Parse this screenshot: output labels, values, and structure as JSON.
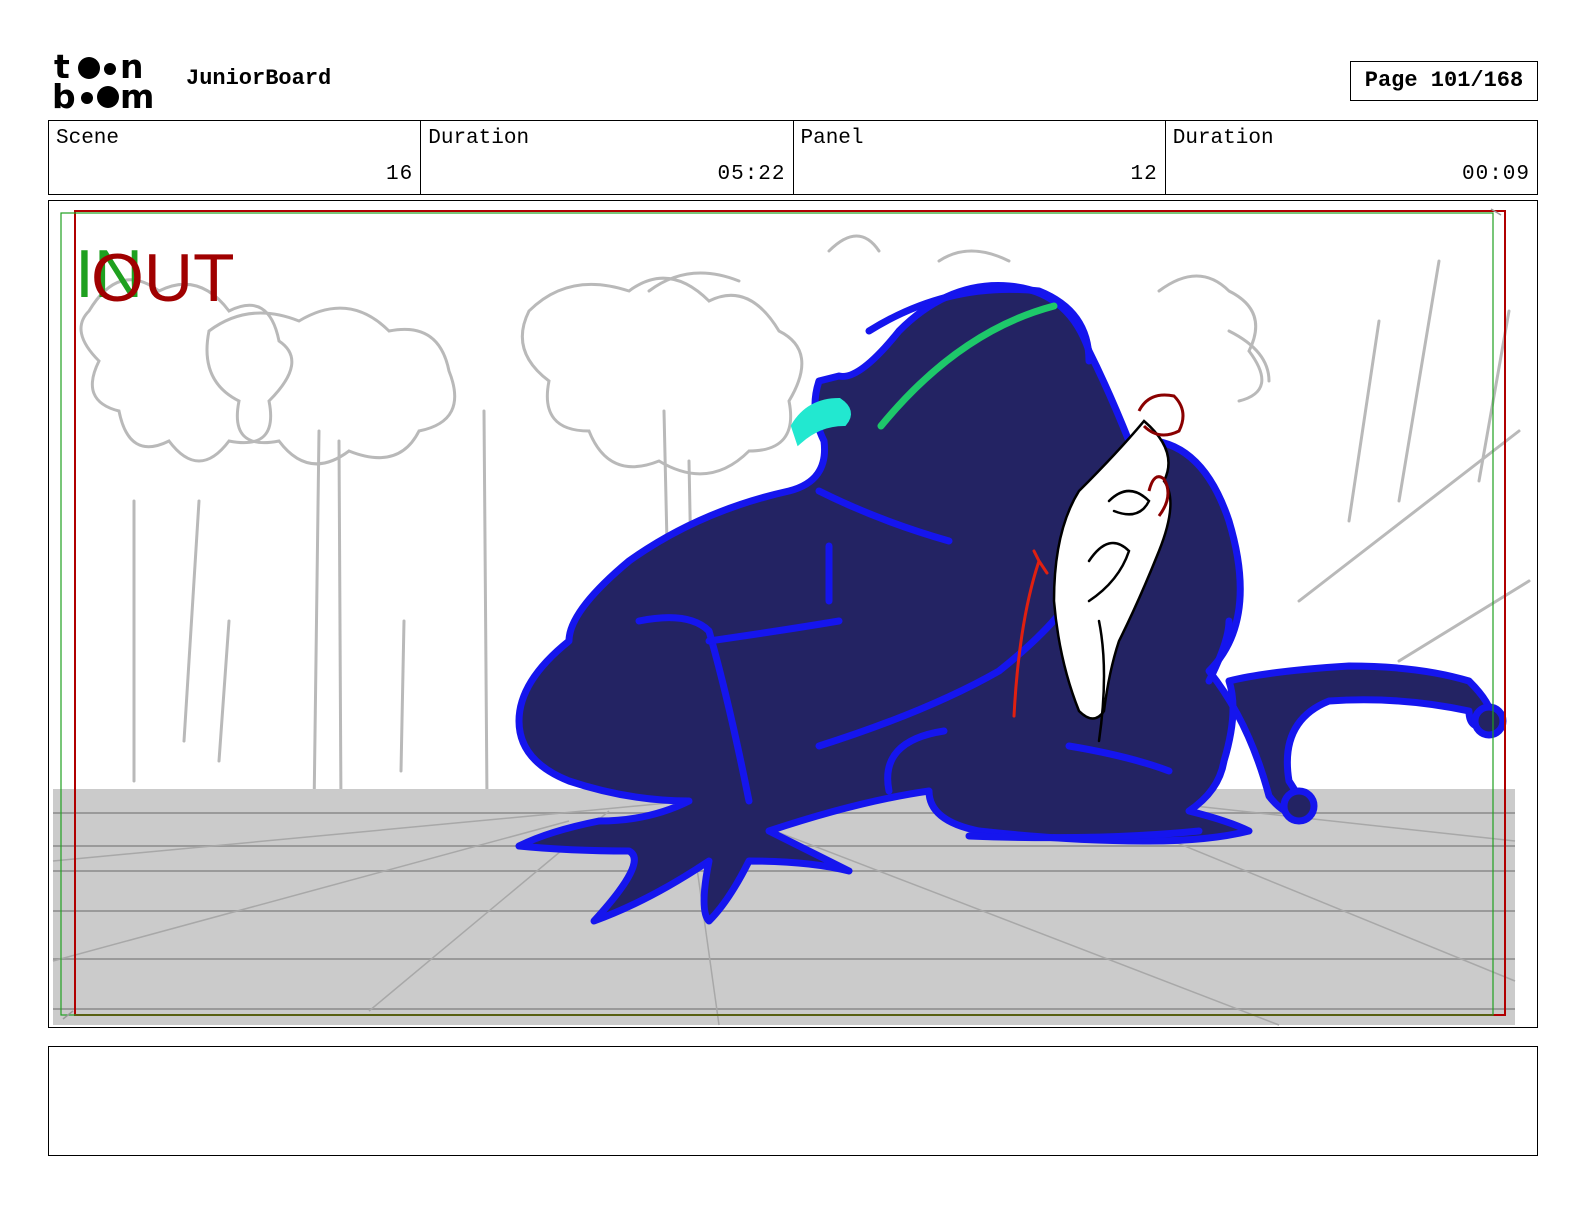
{
  "header": {
    "logo_text_top": "toon",
    "logo_text_bottom": "boom",
    "app_title": "JuniorBoard",
    "page_label": "Page 101/168"
  },
  "info": [
    {
      "label": "Scene",
      "value": "16"
    },
    {
      "label": "Duration",
      "value": "05:22"
    },
    {
      "label": "Panel",
      "value": "12"
    },
    {
      "label": "Duration",
      "value": "00:09"
    }
  ],
  "frame": {
    "in_marker": "IN",
    "out_marker": "OUT",
    "colors": {
      "frog_fill": "#232363",
      "frog_outline": "#1515ee",
      "floor": "#cbcbcb",
      "in_green": "#1fa01f",
      "out_red": "#a00000",
      "highlight_green": "#1ec86a",
      "eye_cyan": "#22e8d0"
    }
  },
  "notes": {
    "text": ""
  }
}
